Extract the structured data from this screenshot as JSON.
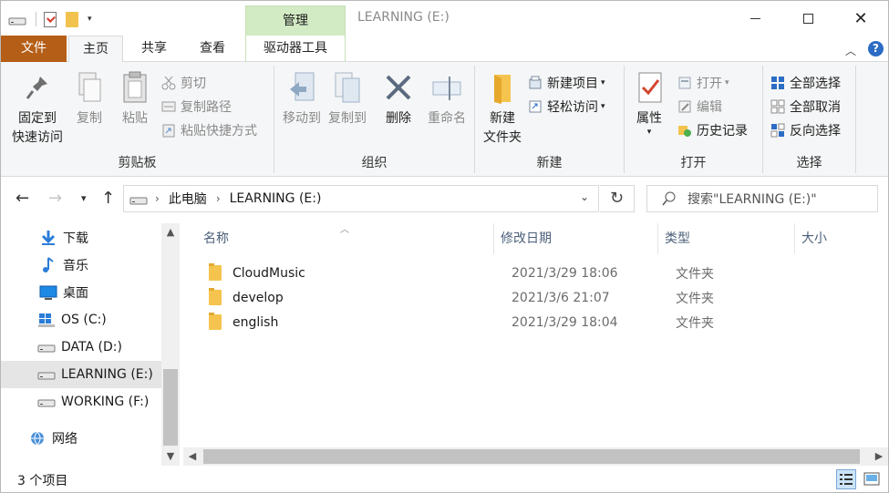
{
  "window": {
    "title": "LEARNING (E:)",
    "context_tab": "管理",
    "quick_access_dropdown": "▾",
    "controls": {
      "minimize": "minimize",
      "maximize": "maximize",
      "close": "✕"
    }
  },
  "tabs": {
    "file": "文件",
    "home": "主页",
    "share": "共享",
    "view": "查看",
    "drive_tools": "驱动器工具",
    "expand": "︿",
    "help": "?"
  },
  "ribbon": {
    "clipboard": {
      "label": "剪贴板",
      "pin_line1": "固定到",
      "pin_line2": "快速访问",
      "copy": "复制",
      "paste": "粘贴",
      "cut": "剪切",
      "copy_path": "复制路径",
      "paste_shortcut": "粘贴快捷方式"
    },
    "organize": {
      "label": "组织",
      "move_to": "移动到",
      "copy_to": "复制到",
      "delete": "删除",
      "rename": "重命名"
    },
    "new": {
      "label": "新建",
      "new_folder_line1": "新建",
      "new_folder_line2": "文件夹",
      "new_item": "新建项目",
      "easy_access": "轻松访问"
    },
    "open": {
      "label": "打开",
      "properties": "属性",
      "open": "打开",
      "edit": "编辑",
      "history": "历史记录"
    },
    "select": {
      "label": "选择",
      "select_all": "全部选择",
      "select_none": "全部取消",
      "invert": "反向选择"
    }
  },
  "address": {
    "crumbs": [
      "此电脑",
      "LEARNING (E:)"
    ],
    "search_placeholder": "搜索\"LEARNING (E:)\""
  },
  "nav_pane": {
    "items": [
      {
        "label": "下载",
        "icon": "download-icon"
      },
      {
        "label": "音乐",
        "icon": "music-icon"
      },
      {
        "label": "桌面",
        "icon": "desktop-icon"
      },
      {
        "label": "OS (C:)",
        "icon": "windows-drive-icon"
      },
      {
        "label": "DATA (D:)",
        "icon": "drive-icon"
      },
      {
        "label": "LEARNING (E:)",
        "icon": "drive-icon",
        "selected": true
      },
      {
        "label": "WORKING (F:)",
        "icon": "drive-icon"
      },
      {
        "label": "网络",
        "icon": "network-icon"
      }
    ]
  },
  "file_list": {
    "columns": [
      "名称",
      "修改日期",
      "类型",
      "大小"
    ],
    "rows": [
      {
        "name": "CloudMusic",
        "date": "2021/3/29 18:06",
        "type": "文件夹",
        "size": ""
      },
      {
        "name": "develop",
        "date": "2021/3/6 21:07",
        "type": "文件夹",
        "size": ""
      },
      {
        "name": "english",
        "date": "2021/3/29 18:04",
        "type": "文件夹",
        "size": ""
      }
    ]
  },
  "status": {
    "item_count": "3 个项目"
  },
  "colors": {
    "file_tab": "#b55e17",
    "context_tab": "#d2ebc4",
    "accent": "#2b6cc4",
    "folder": "#f5c44f"
  }
}
